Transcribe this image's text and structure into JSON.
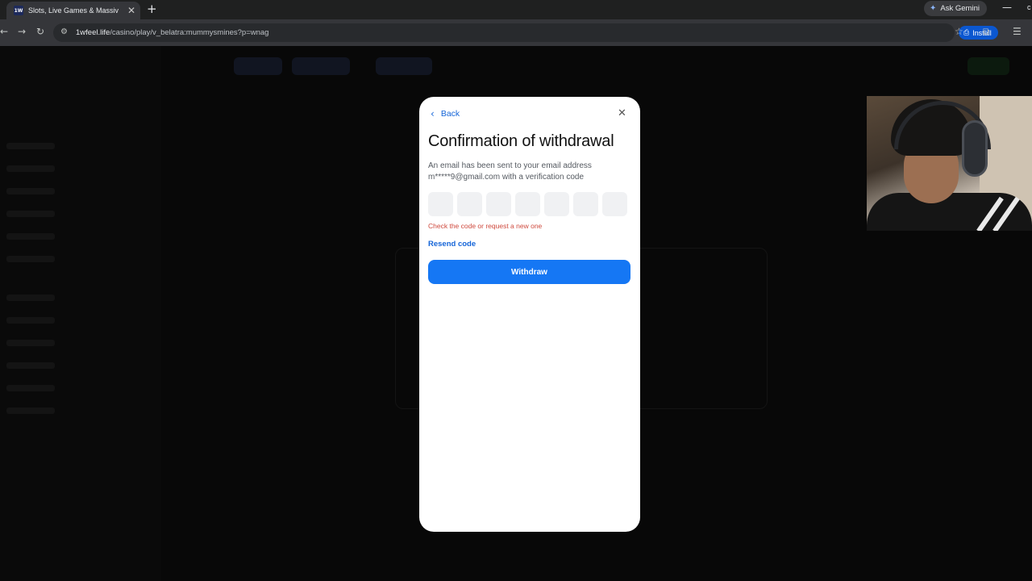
{
  "browser": {
    "tab_title": "Slots, Live Games & Massive Ja",
    "tab_favicon": "1W",
    "gemini_label": "Ask Gemini",
    "url_domain": "1wfeel.life",
    "url_path": "/casino/play/v_belatra:mummysmines?p=wnag",
    "install_label": "Install",
    "window_edge_text": "c"
  },
  "modal": {
    "back_label": "Back",
    "title": "Confirmation of withdrawal",
    "description": "An email has been sent to your email address m*****9@gmail.com with a verification code",
    "code_fields": [
      "",
      "",
      "",
      "",
      "",
      "",
      ""
    ],
    "error_text": "Check the code or request a new one",
    "resend_label": "Resend code",
    "withdraw_label": "Withdraw"
  },
  "colors": {
    "accent": "#1577f4",
    "link": "#1565d8",
    "error": "#cf4a3e",
    "install": "#0b57d0"
  },
  "icons": [
    "back-chevron-icon",
    "close-icon",
    "site-info-icon",
    "bookmark-star-icon",
    "gemini-icon",
    "install-icon",
    "extensions-icon",
    "new-tab-icon"
  ]
}
